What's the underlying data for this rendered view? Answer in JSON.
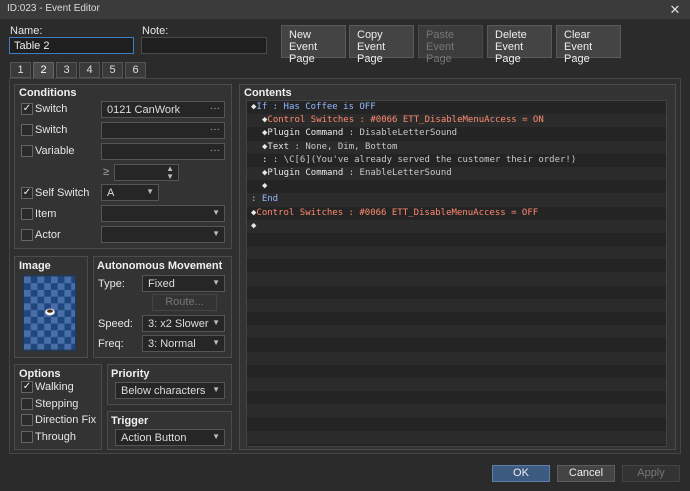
{
  "window": {
    "title": "ID:023 - Event Editor",
    "close_glyph": "✕"
  },
  "name": {
    "label": "Name:",
    "value": "Table 2"
  },
  "note": {
    "label": "Note:",
    "value": ""
  },
  "page_buttons": {
    "new": [
      "New",
      "Event Page"
    ],
    "copy": [
      "Copy",
      "Event Page"
    ],
    "paste": [
      "Paste",
      "Event Page"
    ],
    "delete": [
      "Delete",
      "Event Page"
    ],
    "clear": [
      "Clear",
      "Event Page"
    ]
  },
  "tabs": [
    "1",
    "2",
    "3",
    "4",
    "5",
    "6"
  ],
  "active_tab": "2",
  "conditions": {
    "title": "Conditions",
    "switch1": {
      "label": "Switch",
      "checked": true,
      "value": "0121 CanWork",
      "dots": "···"
    },
    "switch2": {
      "label": "Switch",
      "checked": false,
      "value": "",
      "dots": "···"
    },
    "variable": {
      "label": "Variable",
      "checked": false,
      "value": "",
      "dots": "···"
    },
    "variable_op": "≥",
    "self_switch": {
      "label": "Self Switch",
      "checked": true,
      "value": "A"
    },
    "item": {
      "label": "Item",
      "checked": false,
      "value": ""
    },
    "actor": {
      "label": "Actor",
      "checked": false,
      "value": ""
    }
  },
  "image": {
    "title": "Image"
  },
  "autonomous": {
    "title": "Autonomous Movement",
    "type_label": "Type:",
    "type_value": "Fixed",
    "route_label": "Route...",
    "speed_label": "Speed:",
    "speed_value": "3: x2 Slower",
    "freq_label": "Freq:",
    "freq_value": "3: Normal"
  },
  "options": {
    "title": "Options",
    "walking": {
      "label": "Walking",
      "checked": true
    },
    "stepping": {
      "label": "Stepping",
      "checked": false
    },
    "direction_fix": {
      "label": "Direction Fix",
      "checked": false
    },
    "through": {
      "label": "Through",
      "checked": false
    }
  },
  "priority": {
    "title": "Priority",
    "value": "Below characters"
  },
  "trigger": {
    "title": "Trigger",
    "value": "Action Button"
  },
  "contents": {
    "title": "Contents",
    "rows": [
      {
        "indent": 0,
        "parts": [
          [
            "◆",
            "c-white"
          ],
          [
            "If",
            "c-blue"
          ],
          [
            " : Has Coffee is OFF",
            "c-blue"
          ]
        ]
      },
      {
        "indent": 1,
        "parts": [
          [
            "◆",
            "c-white"
          ],
          [
            "Control Switches",
            "c-red"
          ],
          [
            " : #0066 ETT_DisableMenuAccess = ON",
            "c-red"
          ]
        ]
      },
      {
        "indent": 1,
        "parts": [
          [
            "◆",
            "c-white"
          ],
          [
            "Plugin Command",
            "c-white"
          ],
          [
            " : DisableLetterSound",
            "c-gray"
          ]
        ]
      },
      {
        "indent": 1,
        "parts": [
          [
            "◆",
            "c-white"
          ],
          [
            "Text",
            "c-white"
          ],
          [
            " : None, Dim, Bottom",
            "c-gray"
          ]
        ]
      },
      {
        "indent": 1,
        "parts": [
          [
            ":",
            "c-white"
          ],
          [
            "      : \\C[6](You've already served the customer their order!)",
            "c-gray"
          ]
        ]
      },
      {
        "indent": 1,
        "parts": [
          [
            "◆",
            "c-white"
          ],
          [
            "Plugin Command",
            "c-white"
          ],
          [
            " : EnableLetterSound",
            "c-gray"
          ]
        ]
      },
      {
        "indent": 1,
        "parts": [
          [
            "◆",
            "c-white"
          ]
        ]
      },
      {
        "indent": 0,
        "parts": [
          [
            " : ",
            "c-blue"
          ],
          [
            "End",
            "c-blue"
          ]
        ]
      },
      {
        "indent": 0,
        "parts": [
          [
            "◆",
            "c-white"
          ],
          [
            "Control Switches",
            "c-red"
          ],
          [
            " : #0066 ETT_DisableMenuAccess = OFF",
            "c-red"
          ]
        ]
      },
      {
        "indent": 0,
        "parts": [
          [
            "◆",
            "c-white"
          ]
        ]
      }
    ],
    "total_rows": 26
  },
  "footer": {
    "ok": "OK",
    "cancel": "Cancel",
    "apply": "Apply"
  },
  "colors": {
    "accent": "#3d7fbf",
    "switch_red": "#ff8a70",
    "branch_blue": "#8fb8ff",
    "map_tile_dark": "#1a3a66",
    "map_tile_light": "#4a6fa8"
  }
}
